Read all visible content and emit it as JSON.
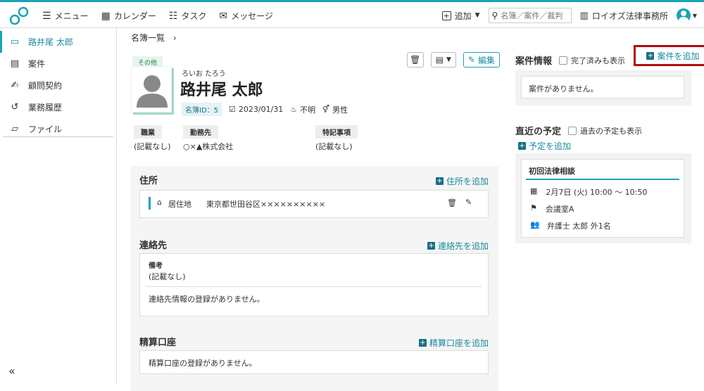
{
  "topbar": {
    "menu": "メニュー",
    "calendar": "カレンダー",
    "task": "タスク",
    "message": "メッセージ",
    "add": "追加",
    "search_placeholder": "名簿／案件／裁判",
    "firm": "ロイオズ法律事務所",
    "brand_color": "#1aa3b8"
  },
  "sidebar": {
    "items": [
      {
        "label": "路井尾 太郎",
        "icon": "id-card-icon"
      },
      {
        "label": "案件",
        "icon": "document-icon"
      },
      {
        "label": "顧問契約",
        "icon": "signature-icon"
      },
      {
        "label": "業務履歴",
        "icon": "history-icon"
      },
      {
        "label": "ファイル",
        "icon": "folder-icon"
      }
    ],
    "collapse": "«"
  },
  "breadcrumb": "名簿一覧",
  "profile": {
    "tag": "その他",
    "kana": "ろいお たろう",
    "name": "路井尾 太郎",
    "id_label": "名簿ID：5",
    "date": "2023/01/31",
    "unknown": "不明",
    "gender": "男性",
    "edit": "編集",
    "fields": {
      "job_label": "職業",
      "job_value": "(記載なし)",
      "work_label": "勤務先",
      "work_value": "○×▲株式会社",
      "note_label": "特記事項",
      "note_value": "(記載なし)"
    }
  },
  "address": {
    "title": "住所",
    "add": "住所を追加",
    "type": "居住地",
    "value": "東京都世田谷区××××××××××"
  },
  "contact": {
    "title": "連絡先",
    "add": "連絡先を追加",
    "note_label": "備考",
    "note_value": "(記載なし)",
    "empty": "連絡先情報の登録がありません。"
  },
  "account": {
    "title": "精算口座",
    "add": "精算口座を追加",
    "empty": "精算口座の登録がありません。"
  },
  "cases": {
    "title": "案件情報",
    "show_done": "完了済みも表示",
    "add": "案件を追加",
    "empty": "案件がありません。"
  },
  "schedule": {
    "title": "直近の予定",
    "show_past": "過去の予定も表示",
    "add": "予定を追加",
    "event_title": "初回法律相談",
    "event_date": "2月7日 (火) 10:00 ～ 10:50",
    "event_place": "会議室A",
    "event_people": "弁護士 太郎 外1名"
  }
}
